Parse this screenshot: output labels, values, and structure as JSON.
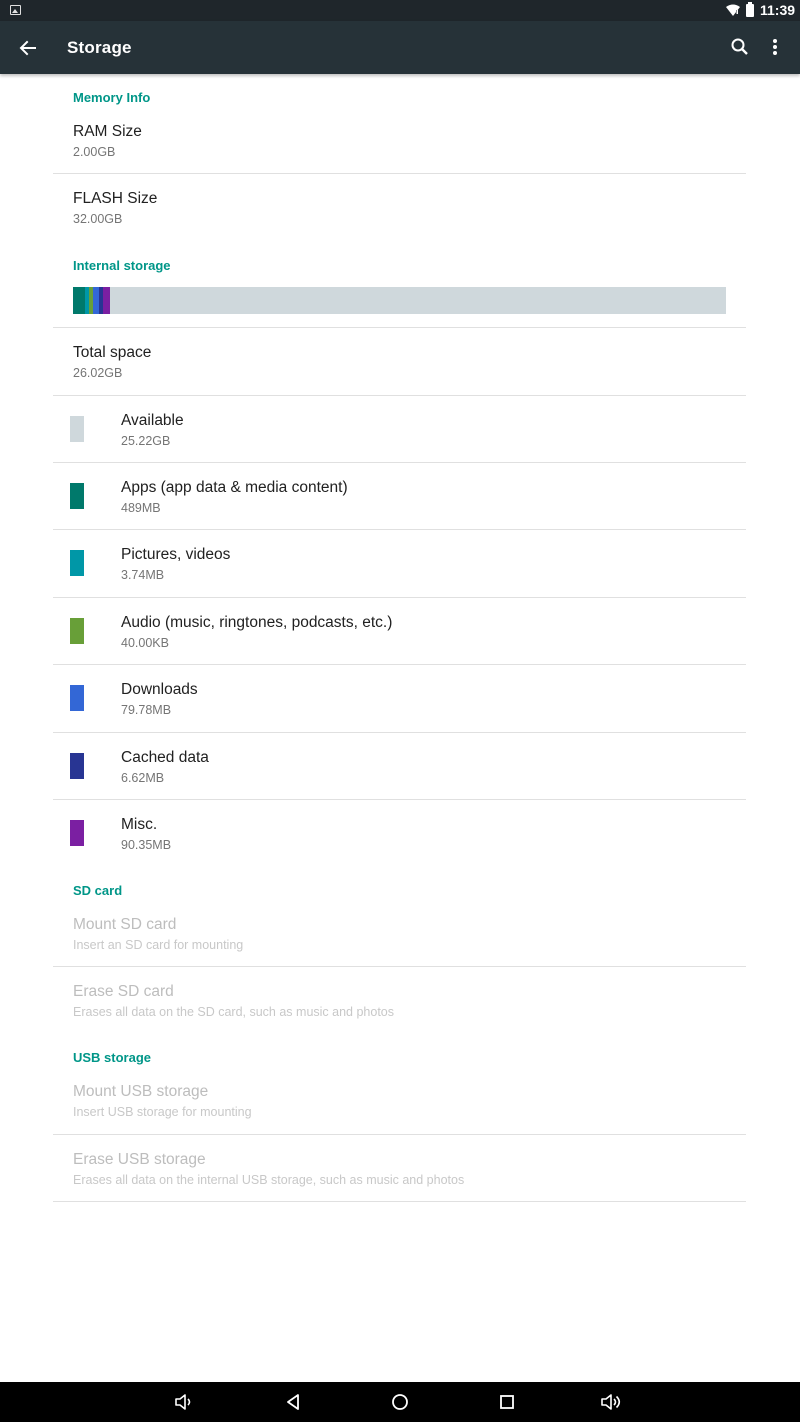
{
  "status_bar": {
    "time": "11:39",
    "icons": [
      "gallery-icon",
      "wifi-icon",
      "battery-icon"
    ]
  },
  "app_bar": {
    "title": "Storage",
    "back_icon": "arrow-back-icon",
    "search_icon": "search-icon",
    "more_icon": "more-vert-icon"
  },
  "memory_info": {
    "header": "Memory Info",
    "items": [
      {
        "title": "RAM Size",
        "value": "2.00GB"
      },
      {
        "title": "FLASH Size",
        "value": "32.00GB"
      }
    ]
  },
  "internal_storage": {
    "header": "Internal storage",
    "total": {
      "title": "Total space",
      "value": "26.02GB"
    },
    "usage_bar_fractions": [
      {
        "name": "Apps",
        "fraction": 0.019,
        "color": "#00796b"
      },
      {
        "name": "Pictures, videos",
        "fraction": 0.006,
        "color": "#0097a7"
      },
      {
        "name": "Audio",
        "fraction": 0.006,
        "color": "#689f38"
      },
      {
        "name": "Downloads",
        "fraction": 0.009,
        "color": "#3367d6"
      },
      {
        "name": "Cached data",
        "fraction": 0.006,
        "color": "#283593"
      },
      {
        "name": "Misc.",
        "fraction": 0.011,
        "color": "#7b1fa2"
      }
    ],
    "categories": [
      {
        "label": "Available",
        "size": "25.22GB",
        "color": "#cfd8dc"
      },
      {
        "label": "Apps (app data & media content)",
        "size": "489MB",
        "color": "#00796b"
      },
      {
        "label": "Pictures, videos",
        "size": "3.74MB",
        "color": "#0097a7"
      },
      {
        "label": "Audio (music, ringtones, podcasts, etc.)",
        "size": "40.00KB",
        "color": "#689f38"
      },
      {
        "label": "Downloads",
        "size": "79.78MB",
        "color": "#3367d6"
      },
      {
        "label": "Cached data",
        "size": "6.62MB",
        "color": "#283593"
      },
      {
        "label": "Misc.",
        "size": "90.35MB",
        "color": "#7b1fa2"
      }
    ]
  },
  "sd_card": {
    "header": "SD card",
    "items": [
      {
        "title": "Mount SD card",
        "summary": "Insert an SD card for mounting"
      },
      {
        "title": "Erase SD card",
        "summary": "Erases all data on the SD card, such as music and photos"
      }
    ]
  },
  "usb_storage": {
    "header": "USB storage",
    "items": [
      {
        "title": "Mount USB storage",
        "summary": "Insert USB storage for mounting"
      },
      {
        "title": "Erase USB storage",
        "summary": "Erases all data on the internal USB storage, such as music and photos"
      }
    ]
  },
  "nav_bar": {
    "icons": [
      "volume-down-icon",
      "back-icon",
      "home-icon",
      "recents-icon",
      "volume-up-icon"
    ]
  }
}
